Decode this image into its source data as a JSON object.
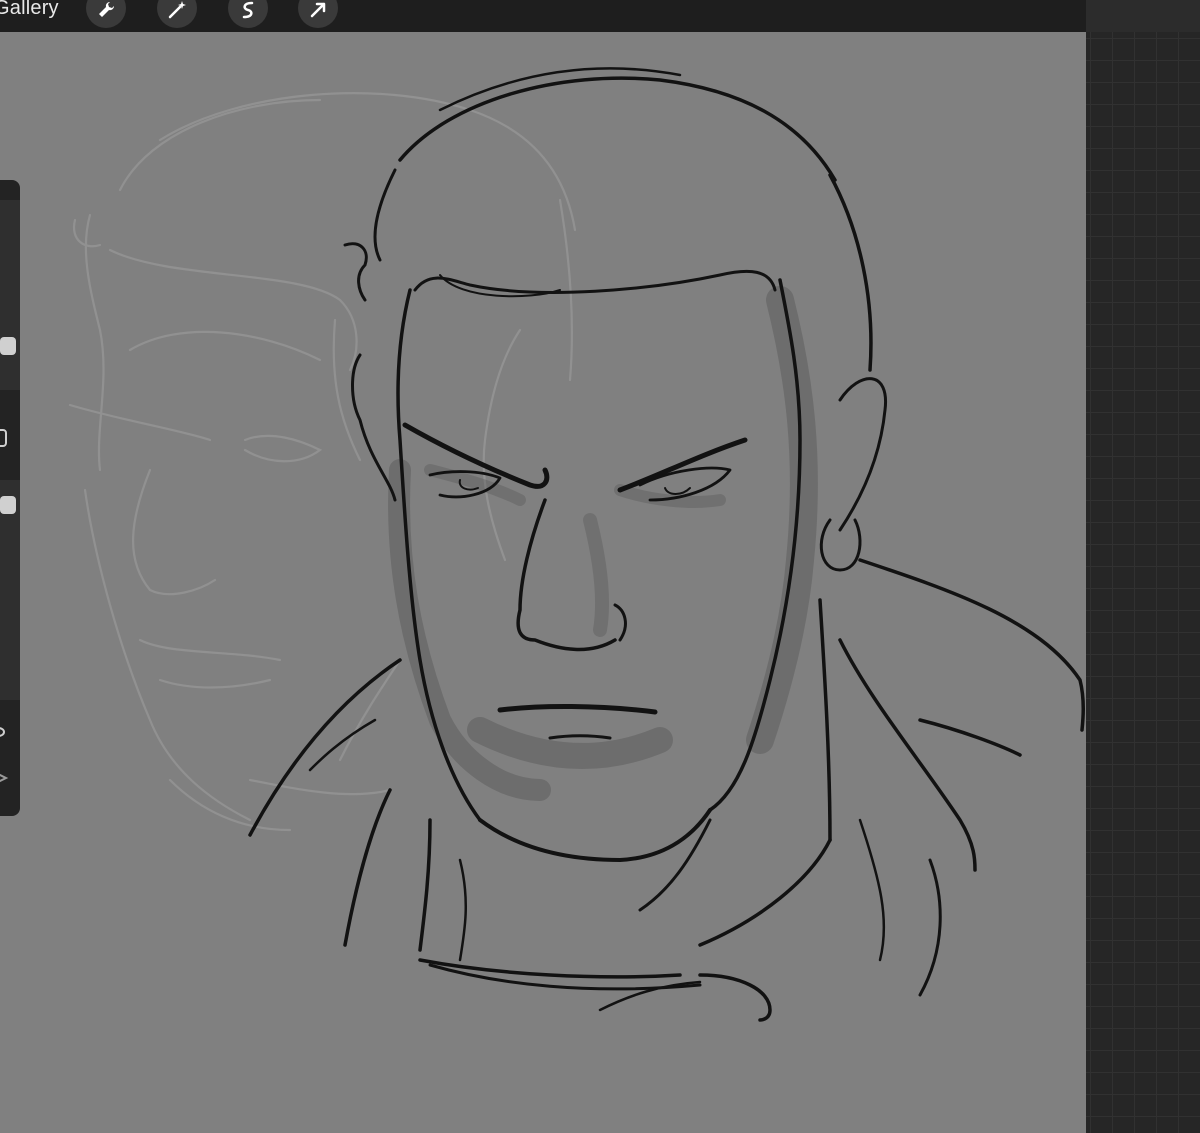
{
  "toolbar": {
    "gallery_label": "Gallery",
    "tools": [
      {
        "name": "actions",
        "icon": "wrench-icon"
      },
      {
        "name": "adjustments",
        "icon": "magic-wand-icon"
      },
      {
        "name": "selection",
        "icon": "selection-s-icon"
      },
      {
        "name": "transform",
        "icon": "arrow-cursor-icon"
      }
    ]
  },
  "sidebar": {
    "size_slider_value": 0.57,
    "opacity_slider_value": 0.36,
    "buttons": [
      "modify-square-icon",
      "undo-icon",
      "redo-icon"
    ]
  },
  "colors": {
    "canvas": "#808080",
    "toolbar": "#1e1e1e",
    "sidebar": "#232323",
    "ink": "#121212",
    "sketch": "#9a9a9a"
  }
}
